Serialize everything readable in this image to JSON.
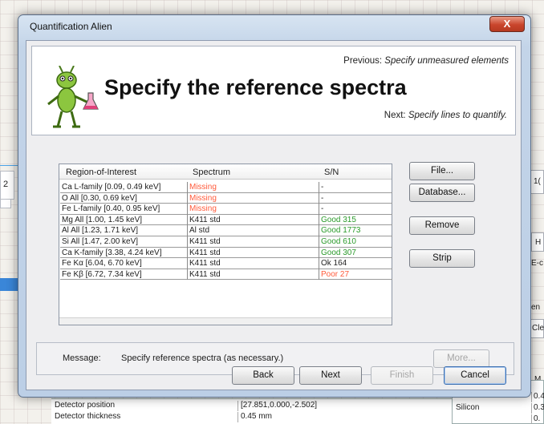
{
  "window": {
    "title": "Quantification Alien",
    "close_glyph": "X"
  },
  "header": {
    "previous_label": "Previous:",
    "previous_value": "Specify unmeasured elements",
    "heading": "Specify the reference spectra",
    "next_label": "Next:",
    "next_value": "Specify lines to quantify.",
    "mascot_icon": "alien-mascot-icon"
  },
  "roi_table": {
    "columns": [
      "Region-of-Interest",
      "Spectrum",
      "S/N"
    ],
    "rows": [
      {
        "roi": "Ca L-family [0.09, 0.49 keV]",
        "spectrum": "Missing",
        "sn": "-",
        "spectrum_status": "missing",
        "sn_status": "ok"
      },
      {
        "roi": "O All [0.30, 0.69 keV]",
        "spectrum": "Missing",
        "sn": "-",
        "spectrum_status": "missing",
        "sn_status": "ok"
      },
      {
        "roi": "Fe L-family [0.40, 0.95 keV]",
        "spectrum": "Missing",
        "sn": "-",
        "spectrum_status": "missing",
        "sn_status": "ok"
      },
      {
        "roi": "Mg All [1.00, 1.45 keV]",
        "spectrum": "K411 std",
        "sn": "Good 315",
        "spectrum_status": "ok",
        "sn_status": "good"
      },
      {
        "roi": "Al All [1.23, 1.71 keV]",
        "spectrum": "Al std",
        "sn": "Good 1773",
        "spectrum_status": "ok",
        "sn_status": "good"
      },
      {
        "roi": "Si All [1.47, 2.00 keV]",
        "spectrum": "K411 std",
        "sn": "Good 610",
        "spectrum_status": "ok",
        "sn_status": "good"
      },
      {
        "roi": "Ca K-family [3.38, 4.24 keV]",
        "spectrum": "K411 std",
        "sn": "Good 307",
        "spectrum_status": "ok",
        "sn_status": "good"
      },
      {
        "roi": "Fe Kα [6.04, 6.70 keV]",
        "spectrum": "K411 std",
        "sn": "Ok 164",
        "spectrum_status": "ok",
        "sn_status": "ok"
      },
      {
        "roi": "Fe Kβ [6.72, 7.34 keV]",
        "spectrum": "K411 std",
        "sn": "Poor 27",
        "spectrum_status": "ok",
        "sn_status": "poor"
      }
    ]
  },
  "side_buttons": {
    "file": "File...",
    "database": "Database...",
    "remove": "Remove",
    "strip": "Strip"
  },
  "message": {
    "label": "Message:",
    "text": "Specify reference spectra (as necessary.)",
    "more_button": "More..."
  },
  "footer_buttons": {
    "back": "Back",
    "next": "Next",
    "finish": "Finish",
    "cancel": "Cancel"
  },
  "background": {
    "left_box_text": "2",
    "right_labels": [
      "1(",
      "H",
      "E-c",
      "en",
      "Clea",
      "M"
    ],
    "table_rows": [
      {
        "name": "Detector position",
        "value": "[27.851,0.000,-2.502]"
      },
      {
        "name": "Detector thickness",
        "value": "0.45 mm"
      }
    ],
    "right_table": [
      {
        "name": "",
        "value": "0.4"
      },
      {
        "name": "Silicon",
        "value": "0.3"
      },
      {
        "name": "",
        "value": "0."
      }
    ]
  },
  "colors": {
    "missing": "#ff5a3a",
    "good": "#2a9a2a",
    "poor": "#ff5a3a",
    "close_button": "#c9452c"
  }
}
